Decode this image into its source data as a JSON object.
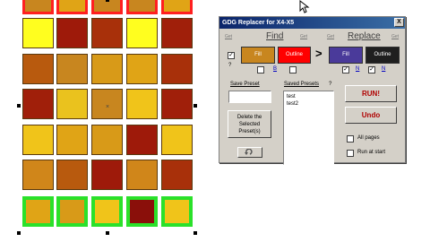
{
  "window": {
    "title": "GDG Replacer for X4-X5",
    "close_label": "X"
  },
  "find": {
    "header": "Find",
    "get_label": "Get",
    "fill_label": "Fill",
    "outline_label": "Outline",
    "fill_color": "#c8861f",
    "outline_color": "#ff0000",
    "fill_checked": "✓",
    "link_label": "B",
    "question_label": "?"
  },
  "arrow": ">",
  "replace": {
    "header": "Replace",
    "get_label": "Get",
    "fill_label": "Fill",
    "outline_label": "Outline",
    "fill_color": "#4a3a9a",
    "outline_color": "#1f1f1f",
    "fill_checked": "✓",
    "outline_checked": "✓",
    "link_label": "N"
  },
  "presets": {
    "save_label": "Save Preset",
    "save_value": "",
    "saved_label": "Saved Presets",
    "saved_question": "?",
    "items": [
      "test",
      "test2"
    ],
    "delete_label": "Delete the Selected Preset(s)"
  },
  "actions": {
    "run_label": "RUN!",
    "undo_label": "Undo",
    "all_pages_label": "All pages",
    "run_at_start_label": "Run at start"
  },
  "canvas": {
    "rows": [
      [
        "#c8861f",
        "#e0a416",
        "#c8861f",
        "#c8861f",
        "#e0a416"
      ],
      [
        "#fffe1f",
        "#9e1a0a",
        "#a8300a",
        "#fffe1f",
        "#a01f0a"
      ],
      [
        "#b85a0e",
        "#c8861f",
        "#d89a18",
        "#e0a416",
        "#a8300a"
      ],
      [
        "#a01f0a",
        "#eac21e",
        "#c8861f",
        "#f0c41a",
        "#a01f0a"
      ],
      [
        "#f0c41a",
        "#e0a416",
        "#d89a18",
        "#9e1a0a",
        "#f0c41a"
      ],
      [
        "#d0861a",
        "#b85a0e",
        "#9e1a0a",
        "#d0861a",
        "#a8300a"
      ],
      [
        "#e0a416",
        "#d89a18",
        "#f0c41a",
        "#8a0f0a",
        "#f0c41a"
      ]
    ],
    "outline_top": "#ff2020",
    "outline_bottom": "#2ae12a"
  }
}
